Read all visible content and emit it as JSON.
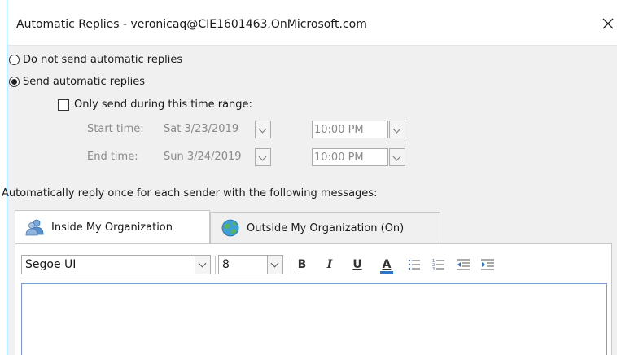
{
  "dialog": {
    "title": "Automatic Replies - veronicaq@CIE1601463.OnMicrosoft.com",
    "close_label": "✕"
  },
  "options": {
    "do_not_send": "Do not send automatic replies",
    "send": "Send automatic replies",
    "selected": "send",
    "time_range_label": "Only send during this time range:",
    "time_range_checked": false
  },
  "schedule": {
    "start_label": "Start time:",
    "start_date": "Sat 3/23/2019",
    "start_time": "10:00 PM",
    "end_label": "End time:",
    "end_date": "Sun 3/24/2019",
    "end_time": "10:00 PM"
  },
  "instructions": "Automatically reply once for each sender with the following messages:",
  "tabs": [
    {
      "label": "Inside My Organization",
      "icon": "people-icon",
      "active": true
    },
    {
      "label": "Outside My Organization (On)",
      "icon": "globe-icon",
      "active": false
    }
  ],
  "toolbar": {
    "font_name": "Segoe UI",
    "font_size": "8",
    "bold": "B",
    "italic": "I",
    "underline": "U",
    "font_color": "A",
    "font_color_hex": "#2e75c8"
  },
  "colors": {
    "accent": "#2b78d0",
    "dialog_bg": "#f0f0f0"
  }
}
